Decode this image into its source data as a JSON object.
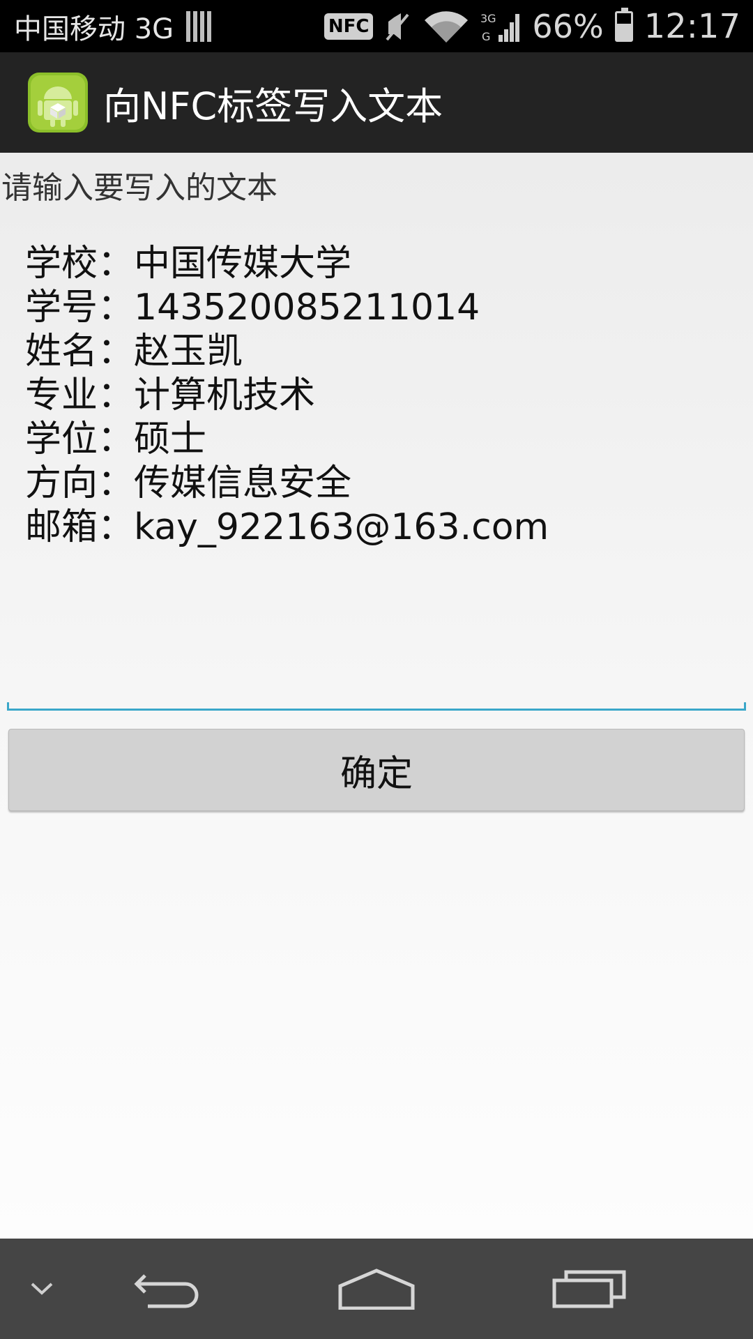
{
  "status_bar": {
    "carrier": "中国移动 3G",
    "nfc_label": "NFC",
    "battery": "66%",
    "time": "12:17",
    "icons": [
      "signal-bars-icon",
      "nfc-icon",
      "mute-icon",
      "wifi-icon",
      "mobile-signal-icon",
      "battery-icon"
    ]
  },
  "action_bar": {
    "title": "向NFC标签写入文本",
    "icon": "android-app-icon"
  },
  "main": {
    "prompt": "请输入要写入的文本",
    "input_lines": [
      "学校：中国传媒大学",
      "学号：143520085211014",
      "姓名：赵玉凯",
      "专业：计算机技术",
      "学位：硕士",
      "方向：传媒信息安全",
      "邮箱：kay_922163@163.com"
    ],
    "confirm_label": "确定"
  },
  "nav_bar": {
    "icons": [
      "hide-keyboard-icon",
      "back-icon",
      "home-icon",
      "recent-apps-icon"
    ]
  },
  "colors": {
    "accent": "#3aa7c9",
    "action_bar": "#232323",
    "nav_bar": "#454545"
  }
}
